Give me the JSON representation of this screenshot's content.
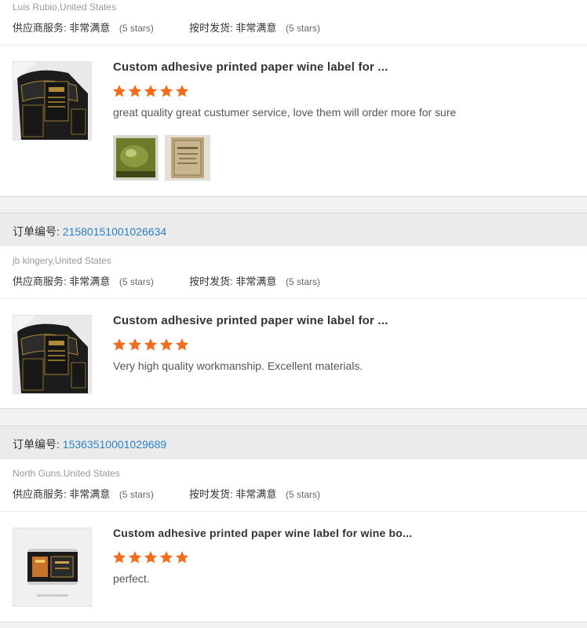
{
  "reviews": [
    {
      "order_label": "",
      "order_number": "",
      "buyer": "Luis Rubio,United States",
      "service_label": "供应商服务:",
      "service_value": "非常满意",
      "service_stars": "(5 stars)",
      "shipping_label": "按时发货:",
      "shipping_value": "非常满意",
      "shipping_stars": "(5 stars)",
      "product_title": "Custom adhesive printed paper wine label for ...",
      "rating": 5,
      "comment": "great quality great custumer service, love them will order more for sure",
      "photos": [
        "photo-green-bottle",
        "photo-gold-label"
      ]
    },
    {
      "order_label": "订单编号:",
      "order_number": "21580151001026634",
      "buyer": "jb kingery,United States",
      "service_label": "供应商服务:",
      "service_value": "非常满意",
      "service_stars": "(5 stars)",
      "shipping_label": "按时发货:",
      "shipping_value": "非常满意",
      "shipping_stars": "(5 stars)",
      "product_title": "Custom adhesive printed paper wine label for ...",
      "rating": 5,
      "comment": "Very high quality workmanship. Excellent materials."
    },
    {
      "order_label": "订单编号:",
      "order_number": "15363510001029689",
      "buyer": "North Guns,United States",
      "service_label": "供应商服务:",
      "service_value": "非常满意",
      "service_stars": "(5 stars)",
      "shipping_label": "按时发货:",
      "shipping_value": "非常满意",
      "shipping_stars": "(5 stars)",
      "product_title": "Custom adhesive printed paper wine label for wine bo...",
      "rating": 5,
      "comment": "perfect."
    }
  ],
  "colors": {
    "star": "#f26c1e",
    "order_number": "#2a80c6",
    "order_bar": "#ebebeb"
  }
}
